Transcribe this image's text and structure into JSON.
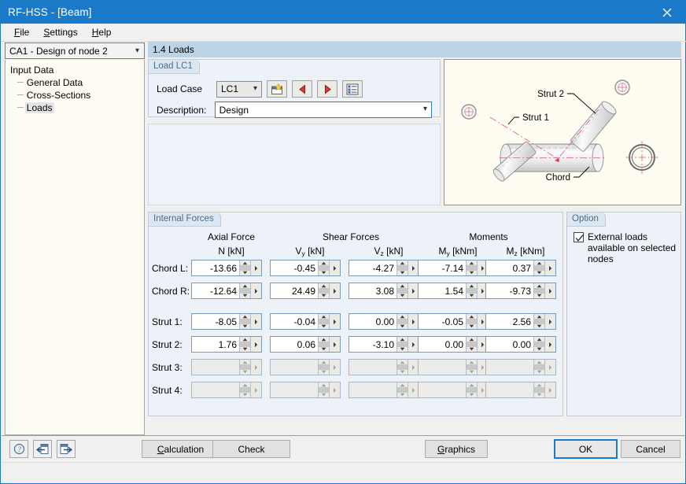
{
  "window": {
    "title": "RF-HSS - [Beam]",
    "close_icon": "close-icon"
  },
  "menu": [
    {
      "label": "File",
      "accel": "F"
    },
    {
      "label": "Settings",
      "accel": "S"
    },
    {
      "label": "Help",
      "accel": "H"
    }
  ],
  "navigator": {
    "combo_value": "CA1 - Design of node 2",
    "tree": {
      "root": "Input Data",
      "items": [
        {
          "label": "General Data",
          "selected": false
        },
        {
          "label": "Cross-Sections",
          "selected": false
        },
        {
          "label": "Loads",
          "selected": true
        }
      ]
    }
  },
  "main": {
    "section_title": "1.4 Loads",
    "load_group": {
      "legend": "Load LC1",
      "load_case_label": "Load Case",
      "load_case_value": "LC1",
      "description_label": "Description:",
      "description_value": "Design",
      "buttons": [
        {
          "name": "new-load-case-button",
          "icon": "new-folder-icon"
        },
        {
          "name": "previous-load-case-button",
          "icon": "arrow-left-icon"
        },
        {
          "name": "next-load-case-button",
          "icon": "arrow-right-icon"
        },
        {
          "name": "load-case-list-button",
          "icon": "list-icon"
        }
      ]
    },
    "picture": {
      "labels": [
        "Strut 2",
        "Strut 1",
        "Chord"
      ]
    },
    "forces_group": {
      "legend": "Internal Forces",
      "column_groups": [
        {
          "title": "Axial Force",
          "span": 1
        },
        {
          "title": "Shear Forces",
          "span": 2
        },
        {
          "title": "Moments",
          "span": 2
        }
      ],
      "columns": [
        {
          "sym": "N",
          "sub": "",
          "unit": "[kN]"
        },
        {
          "sym": "V",
          "sub": "y",
          "unit": "[kN]"
        },
        {
          "sym": "V",
          "sub": "z",
          "unit": "[kN]"
        },
        {
          "sym": "M",
          "sub": "y",
          "unit": "[kNm]"
        },
        {
          "sym": "M",
          "sub": "z",
          "unit": "[kNm]"
        }
      ],
      "rows": [
        {
          "label": "Chord L:",
          "values": [
            "-13.66",
            "-0.45",
            "-4.27",
            "-7.14",
            "0.37"
          ],
          "enabled": true
        },
        {
          "label": "Chord R:",
          "values": [
            "-12.64",
            "24.49",
            "3.08",
            "1.54",
            "-9.73"
          ],
          "enabled": true
        },
        {
          "label": "Strut 1:",
          "values": [
            "-8.05",
            "-0.04",
            "0.00",
            "-0.05",
            "2.56"
          ],
          "enabled": true
        },
        {
          "label": "Strut 2:",
          "values": [
            "1.76",
            "0.06",
            "-3.10",
            "0.00",
            "0.00"
          ],
          "enabled": true
        },
        {
          "label": "Strut 3:",
          "values": [
            "",
            "",
            "",
            "",
            ""
          ],
          "enabled": false
        },
        {
          "label": "Strut 4:",
          "values": [
            "",
            "",
            "",
            "",
            ""
          ],
          "enabled": false
        }
      ]
    },
    "option_group": {
      "legend": "Option",
      "checkbox_label": "External loads available on selected nodes",
      "checked": true
    }
  },
  "footer": {
    "icon_buttons": [
      {
        "name": "help-button",
        "icon": "question-mark-icon"
      },
      {
        "name": "import-button",
        "icon": "arrow-into-window-icon"
      },
      {
        "name": "export-button",
        "icon": "arrow-out-window-icon"
      }
    ],
    "calculation_label": "Calculation",
    "calculation_accel": "C",
    "check_label": "Check",
    "graphics_label": "Graphics",
    "graphics_accel": "G",
    "ok_label": "OK",
    "cancel_label": "Cancel"
  },
  "colors": {
    "title_bar": "#1b79c9",
    "section_header": "#bcd3e6",
    "group_bg": "#edf2f9",
    "legend_text": "#4a6b8a",
    "picture_bg": "#fffdf2",
    "tree_bg": "#fffdf3"
  }
}
